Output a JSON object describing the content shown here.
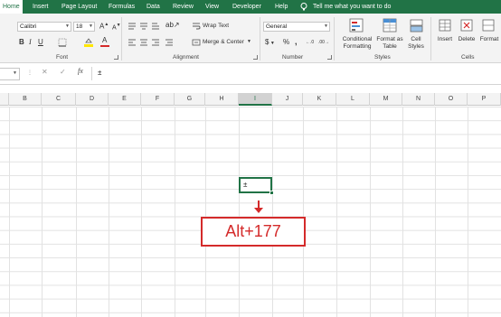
{
  "tabs": [
    "Home",
    "Insert",
    "Page Layout",
    "Formulas",
    "Data",
    "Review",
    "View",
    "Developer",
    "Help"
  ],
  "tell_me": "Tell me what you want to do",
  "font": {
    "name": "Calibri",
    "size": "18",
    "bold": "B",
    "italic": "I",
    "underline": "U",
    "font_color_letter": "A",
    "group_label": "Font"
  },
  "alignment": {
    "wrap_text": "Wrap Text",
    "merge_center": "Merge & Center",
    "group_label": "Alignment"
  },
  "number": {
    "format": "General",
    "currency": "$",
    "percent": "%",
    "comma": ",",
    "group_label": "Number"
  },
  "styles": {
    "conditional_formatting": [
      "Conditional",
      "Formatting"
    ],
    "format_as_table": [
      "Format as",
      "Table"
    ],
    "cell_styles": [
      "Cell",
      "Styles"
    ],
    "group_label": "Styles"
  },
  "cells_group": {
    "insert": "Insert",
    "delete": "Delete",
    "format": "Format",
    "group_label": "Cells"
  },
  "formula_bar": {
    "fx": "fx",
    "content": "±"
  },
  "columns": [
    "B",
    "C",
    "D",
    "E",
    "F",
    "G",
    "H",
    "I",
    "J",
    "K",
    "L",
    "M",
    "N",
    "O",
    "P"
  ],
  "selected_column": "I",
  "active_cell_value": "±",
  "callout_text": "Alt+177",
  "colors": {
    "excel_green": "#217346",
    "callout_red": "#d42a2a"
  }
}
